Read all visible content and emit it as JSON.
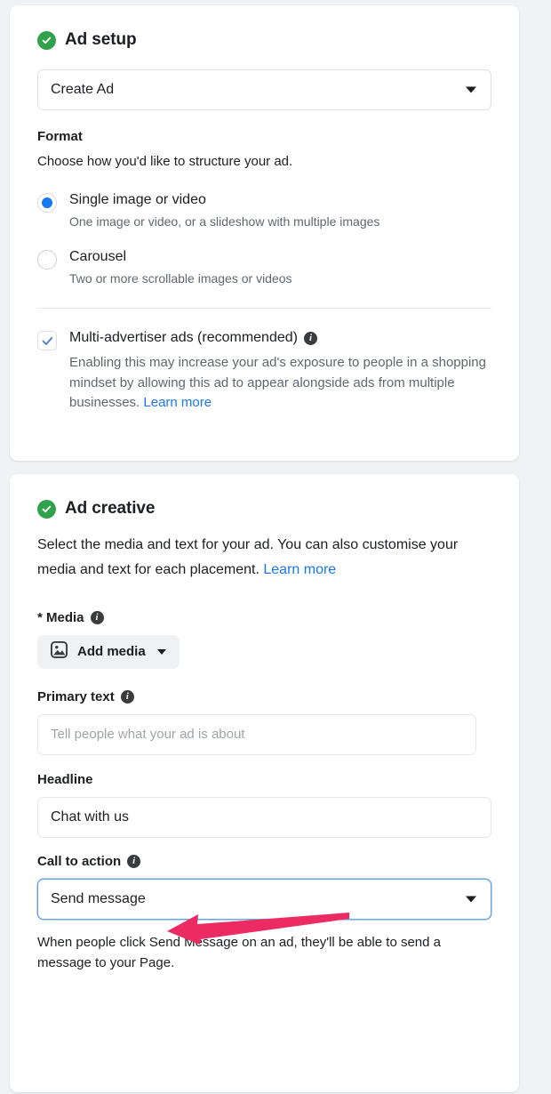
{
  "colors": {
    "page_background": "#f0f2f5",
    "card_background": "#ffffff",
    "accent_blue": "#1877f2",
    "status_green": "#31a24c",
    "annotation_pink": "#ec2b63",
    "link_blue": "#1877f2",
    "text_primary": "#1c1e21",
    "text_secondary": "#606770"
  },
  "ad_setup": {
    "status_icon": "green-check-circle-icon",
    "title": "Ad setup",
    "create_select": {
      "value": "Create Ad",
      "caret_icon": "chevron-down-icon"
    },
    "format": {
      "label": "Format",
      "description": "Choose how you'd like to structure your ad.",
      "options": [
        {
          "title": "Single image or video",
          "description": "One image or video, or a slideshow with multiple images",
          "selected": true
        },
        {
          "title": "Carousel",
          "description": "Two or more scrollable images or videos",
          "selected": false
        }
      ]
    },
    "multi_advertiser": {
      "label": "Multi-advertiser ads (recommended)",
      "info_icon": "info-icon",
      "checked": true,
      "check_icon": "checkmark-icon",
      "description": "Enabling this may increase your ad's exposure to people in a shopping mindset by allowing this ad to appear alongside ads from multiple businesses.",
      "learn_more": "Learn more"
    }
  },
  "ad_creative": {
    "status_icon": "green-check-circle-icon",
    "title": "Ad creative",
    "description": "Select the media and text for your ad. You can also customise your media and text for each placement.",
    "learn_more": "Learn more",
    "media": {
      "label": "* Media",
      "info_icon": "info-icon",
      "button_label": "Add media",
      "button_icon": "image-icon",
      "caret_icon": "chevron-down-icon"
    },
    "primary_text": {
      "label": "Primary text",
      "info_icon": "info-icon",
      "value": "",
      "placeholder": "Tell people what your ad is about"
    },
    "headline": {
      "label": "Headline",
      "value": "Chat with us",
      "placeholder": ""
    },
    "call_to_action": {
      "label": "Call to action",
      "info_icon": "info-icon",
      "value": "Send message",
      "caret_icon": "chevron-down-icon",
      "helper_text": "When people click Send Message on an ad, they'll be able to send a message to your Page."
    }
  },
  "annotation": {
    "type": "arrow",
    "direction": "left",
    "points_at": "call-to-action-label",
    "color": "#ec2b63"
  }
}
